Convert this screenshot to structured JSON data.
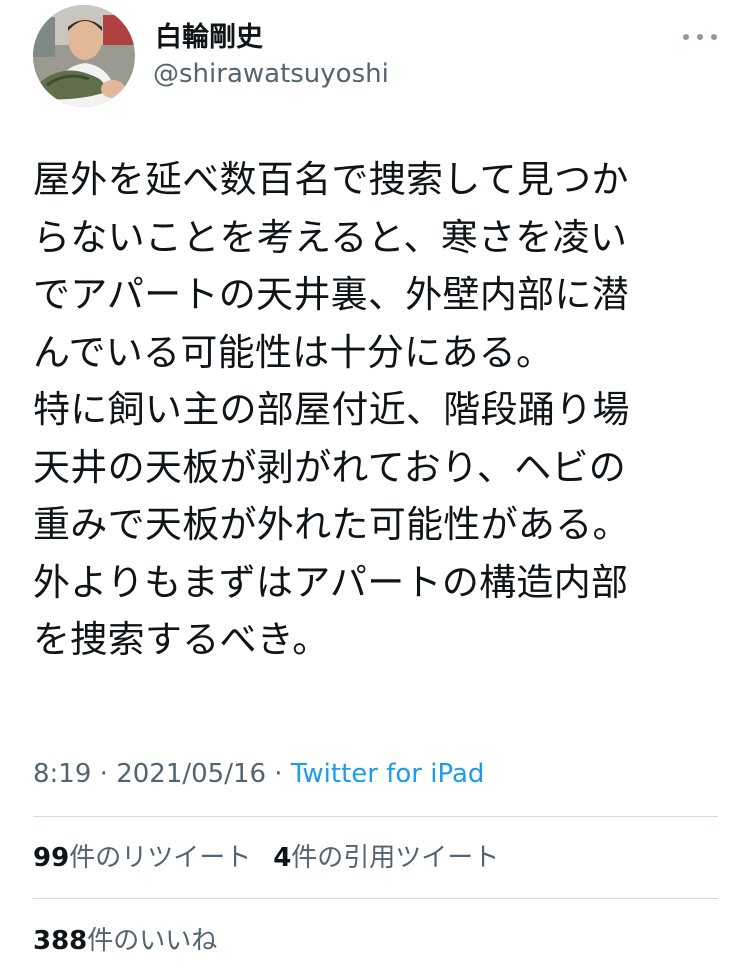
{
  "user": {
    "display_name": "白輪剛史",
    "handle": "@shirawatsuyoshi"
  },
  "menu": {
    "icon": "more-horizontal-icon"
  },
  "tweet": {
    "lines": [
      "屋外を延べ数百名で捜索して見つか",
      "らないことを考えると、寒さを凌い",
      "でアパートの天井裏、外壁内部に潜",
      "んでいる可能性は十分にある。",
      "特に飼い主の部屋付近、階段踊り場",
      "天井の天板が剥がれており、ヘビの",
      "重みで天板が外れた可能性がある。",
      "外よりもまずはアパートの構造内部",
      "を捜索するべき。"
    ]
  },
  "meta": {
    "time": "8:19",
    "separator1": " · ",
    "date": "2021/05/16",
    "separator2": " · ",
    "source": "Twitter for iPad"
  },
  "stats": {
    "retweets_count": "99",
    "retweets_label": "件のリツイート",
    "quotes_count": "4",
    "quotes_label": "件の引用ツイート",
    "likes_count": "388",
    "likes_label": "件のいいね"
  },
  "colors": {
    "text": "#0f1419",
    "secondary": "#536471",
    "link": "#1d9bf0",
    "divider": "#cfd9de"
  }
}
